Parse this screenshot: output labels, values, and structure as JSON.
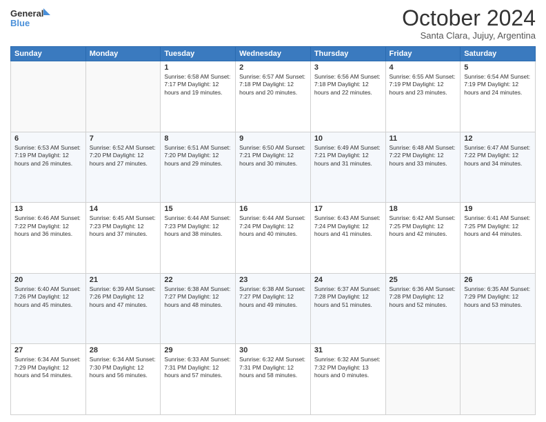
{
  "logo": {
    "line1": "General",
    "line2": "Blue",
    "icon_color": "#4a90d9"
  },
  "header": {
    "month_year": "October 2024",
    "location": "Santa Clara, Jujuy, Argentina"
  },
  "weekdays": [
    "Sunday",
    "Monday",
    "Tuesday",
    "Wednesday",
    "Thursday",
    "Friday",
    "Saturday"
  ],
  "weeks": [
    {
      "days": [
        {
          "num": "",
          "info": ""
        },
        {
          "num": "",
          "info": ""
        },
        {
          "num": "1",
          "info": "Sunrise: 6:58 AM\nSunset: 7:17 PM\nDaylight: 12 hours\nand 19 minutes."
        },
        {
          "num": "2",
          "info": "Sunrise: 6:57 AM\nSunset: 7:18 PM\nDaylight: 12 hours\nand 20 minutes."
        },
        {
          "num": "3",
          "info": "Sunrise: 6:56 AM\nSunset: 7:18 PM\nDaylight: 12 hours\nand 22 minutes."
        },
        {
          "num": "4",
          "info": "Sunrise: 6:55 AM\nSunset: 7:19 PM\nDaylight: 12 hours\nand 23 minutes."
        },
        {
          "num": "5",
          "info": "Sunrise: 6:54 AM\nSunset: 7:19 PM\nDaylight: 12 hours\nand 24 minutes."
        }
      ]
    },
    {
      "days": [
        {
          "num": "6",
          "info": "Sunrise: 6:53 AM\nSunset: 7:19 PM\nDaylight: 12 hours\nand 26 minutes."
        },
        {
          "num": "7",
          "info": "Sunrise: 6:52 AM\nSunset: 7:20 PM\nDaylight: 12 hours\nand 27 minutes."
        },
        {
          "num": "8",
          "info": "Sunrise: 6:51 AM\nSunset: 7:20 PM\nDaylight: 12 hours\nand 29 minutes."
        },
        {
          "num": "9",
          "info": "Sunrise: 6:50 AM\nSunset: 7:21 PM\nDaylight: 12 hours\nand 30 minutes."
        },
        {
          "num": "10",
          "info": "Sunrise: 6:49 AM\nSunset: 7:21 PM\nDaylight: 12 hours\nand 31 minutes."
        },
        {
          "num": "11",
          "info": "Sunrise: 6:48 AM\nSunset: 7:22 PM\nDaylight: 12 hours\nand 33 minutes."
        },
        {
          "num": "12",
          "info": "Sunrise: 6:47 AM\nSunset: 7:22 PM\nDaylight: 12 hours\nand 34 minutes."
        }
      ]
    },
    {
      "days": [
        {
          "num": "13",
          "info": "Sunrise: 6:46 AM\nSunset: 7:22 PM\nDaylight: 12 hours\nand 36 minutes."
        },
        {
          "num": "14",
          "info": "Sunrise: 6:45 AM\nSunset: 7:23 PM\nDaylight: 12 hours\nand 37 minutes."
        },
        {
          "num": "15",
          "info": "Sunrise: 6:44 AM\nSunset: 7:23 PM\nDaylight: 12 hours\nand 38 minutes."
        },
        {
          "num": "16",
          "info": "Sunrise: 6:44 AM\nSunset: 7:24 PM\nDaylight: 12 hours\nand 40 minutes."
        },
        {
          "num": "17",
          "info": "Sunrise: 6:43 AM\nSunset: 7:24 PM\nDaylight: 12 hours\nand 41 minutes."
        },
        {
          "num": "18",
          "info": "Sunrise: 6:42 AM\nSunset: 7:25 PM\nDaylight: 12 hours\nand 42 minutes."
        },
        {
          "num": "19",
          "info": "Sunrise: 6:41 AM\nSunset: 7:25 PM\nDaylight: 12 hours\nand 44 minutes."
        }
      ]
    },
    {
      "days": [
        {
          "num": "20",
          "info": "Sunrise: 6:40 AM\nSunset: 7:26 PM\nDaylight: 12 hours\nand 45 minutes."
        },
        {
          "num": "21",
          "info": "Sunrise: 6:39 AM\nSunset: 7:26 PM\nDaylight: 12 hours\nand 47 minutes."
        },
        {
          "num": "22",
          "info": "Sunrise: 6:38 AM\nSunset: 7:27 PM\nDaylight: 12 hours\nand 48 minutes."
        },
        {
          "num": "23",
          "info": "Sunrise: 6:38 AM\nSunset: 7:27 PM\nDaylight: 12 hours\nand 49 minutes."
        },
        {
          "num": "24",
          "info": "Sunrise: 6:37 AM\nSunset: 7:28 PM\nDaylight: 12 hours\nand 51 minutes."
        },
        {
          "num": "25",
          "info": "Sunrise: 6:36 AM\nSunset: 7:28 PM\nDaylight: 12 hours\nand 52 minutes."
        },
        {
          "num": "26",
          "info": "Sunrise: 6:35 AM\nSunset: 7:29 PM\nDaylight: 12 hours\nand 53 minutes."
        }
      ]
    },
    {
      "days": [
        {
          "num": "27",
          "info": "Sunrise: 6:34 AM\nSunset: 7:29 PM\nDaylight: 12 hours\nand 54 minutes."
        },
        {
          "num": "28",
          "info": "Sunrise: 6:34 AM\nSunset: 7:30 PM\nDaylight: 12 hours\nand 56 minutes."
        },
        {
          "num": "29",
          "info": "Sunrise: 6:33 AM\nSunset: 7:31 PM\nDaylight: 12 hours\nand 57 minutes."
        },
        {
          "num": "30",
          "info": "Sunrise: 6:32 AM\nSunset: 7:31 PM\nDaylight: 12 hours\nand 58 minutes."
        },
        {
          "num": "31",
          "info": "Sunrise: 6:32 AM\nSunset: 7:32 PM\nDaylight: 13 hours\nand 0 minutes."
        },
        {
          "num": "",
          "info": ""
        },
        {
          "num": "",
          "info": ""
        }
      ]
    }
  ]
}
